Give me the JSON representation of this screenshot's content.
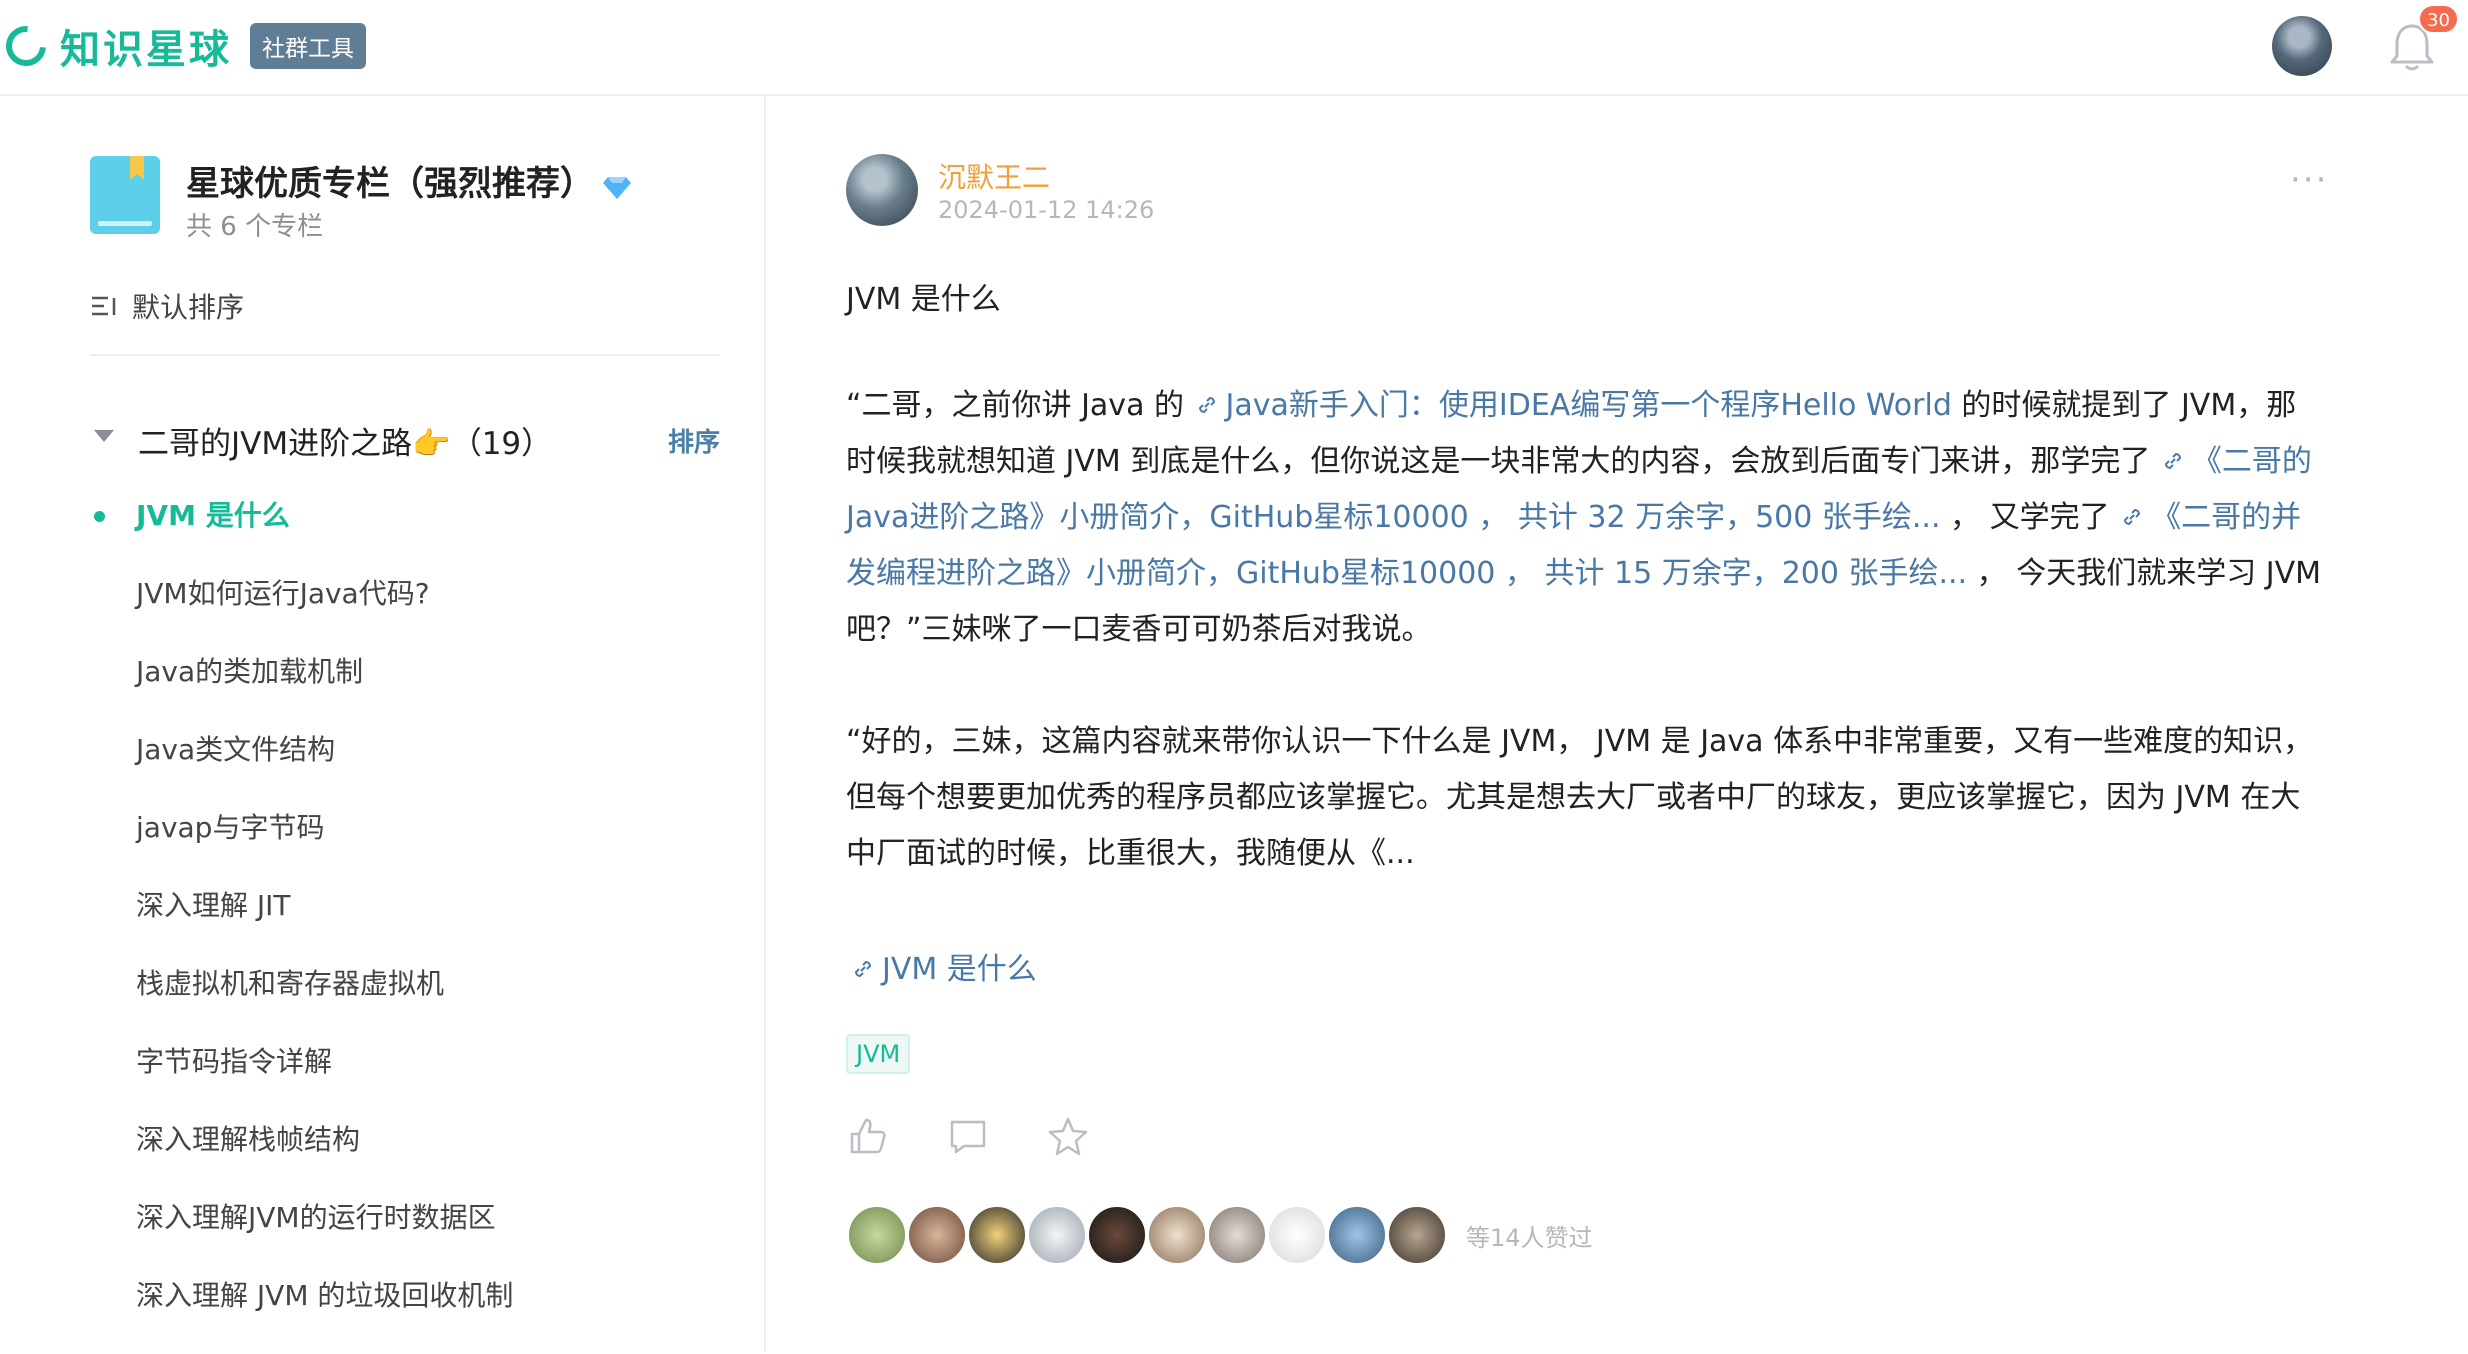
{
  "header": {
    "logo_text": "知识星球",
    "logo_badge": "社群工具",
    "notification_count": "30",
    "brand_color": "#16b998"
  },
  "sidebar": {
    "column_title": "星球优质专栏（强烈推荐）",
    "column_count": "共 6 个专栏",
    "sort_label": "默认排序",
    "group_title": "二哥的JVM进阶之路👉（19）",
    "group_sort": "排序",
    "items": [
      {
        "label": "JVM 是什么",
        "active": true
      },
      {
        "label": "JVM如何运行Java代码?"
      },
      {
        "label": "Java的类加载机制"
      },
      {
        "label": "Java类文件结构"
      },
      {
        "label": "javap与字节码"
      },
      {
        "label": "深入理解 JIT"
      },
      {
        "label": "栈虚拟机和寄存器虚拟机"
      },
      {
        "label": "字节码指令详解"
      },
      {
        "label": "深入理解栈帧结构"
      },
      {
        "label": "深入理解JVM的运行时数据区"
      },
      {
        "label": "深入理解 JVM 的垃圾回收机制"
      }
    ]
  },
  "post": {
    "author": "沉默王二",
    "time": "2024-01-12 14:26",
    "more": "···",
    "title": "JVM 是什么",
    "p1_a": "“二哥，之前你讲 Java 的 ",
    "p1_link1": "Java新手入门：使用IDEA编写第一个程序Hello World",
    "p1_b": " 的时候就提到了 JVM，那时候我就想知道 JVM 到底是什么，但你说这是一块非常大的内容，会放到后面专门来讲，那学完了 ",
    "p1_link2": "《二哥的Java进阶之路》小册简介，GitHub星标10000 ， 共计 32 万余字，500 张手绘...",
    "p1_c": " ， 又学完了 ",
    "p1_link3": "《二哥的并发编程进阶之路》小册简介，GitHub星标10000 ， 共计 15 万余字，200 张手绘...",
    "p1_d": " ， 今天我们就来学习 JVM 吧？”三妹咪了一口麦香可可奶茶后对我说。",
    "p2": "“好的，三妹，这篇内容就来带你认识一下什么是 JVM， JVM 是 Java 体系中非常重要，又有一些难度的知识，但每个想要更加优秀的程序员都应该掌握它。尤其是想去大厂或者中厂的球友，更应该掌握它，因为 JVM 在大中厂面试的时候，比重很大，我随便从《...",
    "article_link": "JVM 是什么",
    "tag": "JVM",
    "like_count": "等14人赞过",
    "link_color": "#4a78a6"
  }
}
